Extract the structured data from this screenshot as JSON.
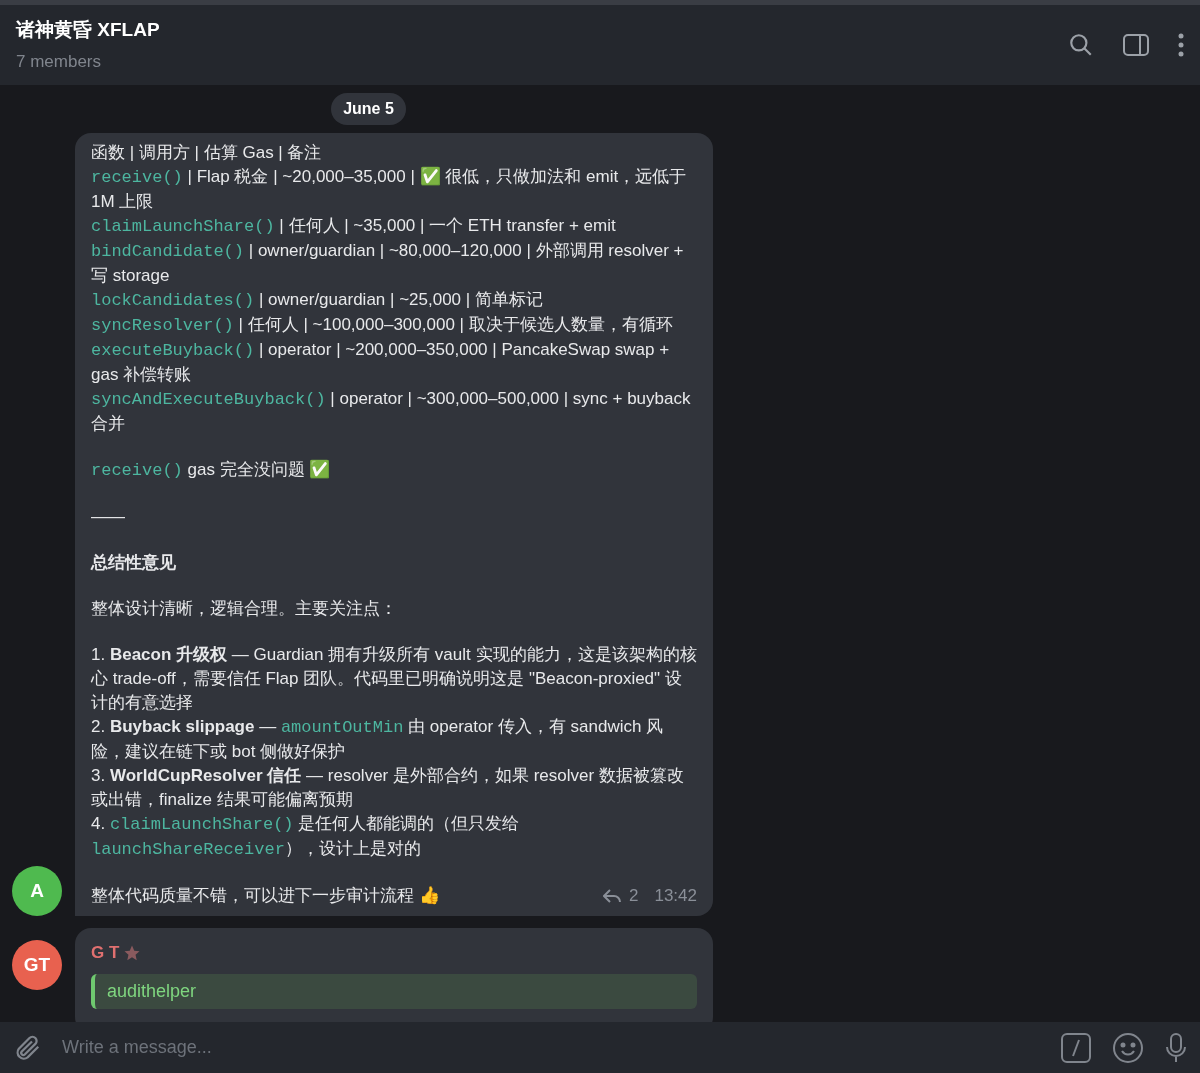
{
  "header": {
    "title": "诸神黄昏 XFLAP",
    "subtitle": "7 members"
  },
  "date_pill": "June 5",
  "messages": [
    {
      "avatar": {
        "initials": "A",
        "color": "#4fba4f"
      },
      "blocks": [
        [
          [
            {
              "kind": "text",
              "text": "函数 | 调用方 | 估算 Gas | 备注"
            }
          ],
          [
            {
              "kind": "code",
              "text": "receive()"
            },
            {
              "kind": "text",
              "text": " | Flap 税金 | ~20,000–35,000 | ✅ 很低，只做加法和 emit，远低于 1M 上限"
            }
          ],
          [
            {
              "kind": "code",
              "text": "claimLaunchShare()"
            },
            {
              "kind": "text",
              "text": " | 任何人 | ~35,000 | 一个 ETH transfer + emit"
            }
          ],
          [
            {
              "kind": "code",
              "text": "bindCandidate()"
            },
            {
              "kind": "text",
              "text": " | owner/guardian | ~80,000–120,000 | 外部调用 resolver + 写 storage"
            }
          ],
          [
            {
              "kind": "code",
              "text": "lockCandidates()"
            },
            {
              "kind": "text",
              "text": " | owner/guardian | ~25,000 | 简单标记"
            }
          ],
          [
            {
              "kind": "code",
              "text": "syncResolver()"
            },
            {
              "kind": "text",
              "text": " | 任何人 | ~100,000–300,000 | 取决于候选人数量，有循环"
            }
          ],
          [
            {
              "kind": "code",
              "text": "executeBuyback()"
            },
            {
              "kind": "text",
              "text": " | operator | ~200,000–350,000 | PancakeSwap swap + gas 补偿转账"
            }
          ],
          [
            {
              "kind": "code",
              "text": "syncAndExecuteBuyback()"
            },
            {
              "kind": "text",
              "text": " | operator | ~300,000–500,000 | sync + buyback 合并"
            }
          ]
        ],
        [
          [
            {
              "kind": "code",
              "text": "receive()"
            },
            {
              "kind": "text",
              "text": " gas 完全没问题 ✅"
            }
          ]
        ],
        [
          [
            {
              "kind": "text",
              "text": "——"
            }
          ]
        ],
        [
          [
            {
              "kind": "bold",
              "text": "总结性意见"
            }
          ]
        ],
        [
          [
            {
              "kind": "text",
              "text": "整体设计清晰，逻辑合理。主要关注点："
            }
          ]
        ],
        [
          [
            {
              "kind": "text",
              "text": "1. "
            },
            {
              "kind": "bold",
              "text": "Beacon 升级权"
            },
            {
              "kind": "text",
              "text": " — Guardian 拥有升级所有 vault 实现的能力，这是该架构的核心 trade-off，需要信任 Flap 团队。代码里已明确说明这是 \"Beacon-proxied\" 设计的有意选择"
            }
          ],
          [
            {
              "kind": "text",
              "text": "2. "
            },
            {
              "kind": "bold",
              "text": "Buyback slippage"
            },
            {
              "kind": "text",
              "text": " — "
            },
            {
              "kind": "code",
              "text": "amountOutMin"
            },
            {
              "kind": "text",
              "text": " 由 operator 传入，有 sandwich 风险，建议在链下或 bot 侧做好保护"
            }
          ],
          [
            {
              "kind": "text",
              "text": "3. "
            },
            {
              "kind": "bold",
              "text": "WorldCupResolver 信任"
            },
            {
              "kind": "text",
              "text": " — resolver 是外部合约，如果 resolver 数据被篡改或出错，finalize 结果可能偏离预期"
            }
          ],
          [
            {
              "kind": "text",
              "text": "4. "
            },
            {
              "kind": "code",
              "text": "claimLaunchShare()"
            },
            {
              "kind": "text",
              "text": " 是任何人都能调的（但只发给 "
            },
            {
              "kind": "code",
              "text": "launchShareReceiver"
            },
            {
              "kind": "text",
              "text": "），设计上是对的"
            }
          ]
        ],
        [
          [
            {
              "kind": "text",
              "text": "整体代码质量不错，可以进下一步审计流程 👍"
            }
          ]
        ]
      ],
      "replies": "2",
      "time": "13:42"
    },
    {
      "avatar": {
        "initials": "GT",
        "color": "#e8614f"
      },
      "sender": "G T",
      "quote_title": "audithelper"
    }
  ],
  "composer": {
    "placeholder": "Write a message..."
  }
}
